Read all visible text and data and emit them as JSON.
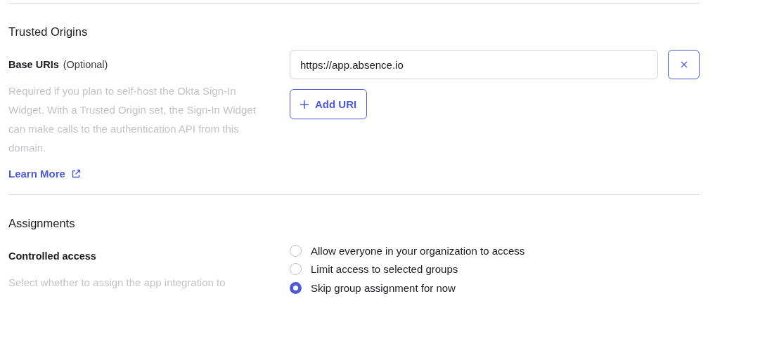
{
  "sections": [
    {
      "kind": "uris",
      "title": "Trusted Origins",
      "field_label": "Base URIs",
      "field_note": "(Optional)",
      "description": "Required if you plan to self-host the Okta Sign-In Widget. With a Trusted Origin set, the Sign-In Widget can make calls to the authentication API from this domain.",
      "link": "Learn More",
      "uris": [
        "https://app.absence.io"
      ],
      "add_button": "Add URI"
    },
    {
      "kind": "radios",
      "title": "Assignments",
      "field_label": "Controlled access",
      "description": "Select whether to assign the app integration to",
      "options": [
        {
          "label": "Allow everyone in your organization to access",
          "selected": false
        },
        {
          "label": "Limit access to selected groups",
          "selected": false
        },
        {
          "label": "Skip group assignment for now",
          "selected": true
        }
      ]
    }
  ]
}
